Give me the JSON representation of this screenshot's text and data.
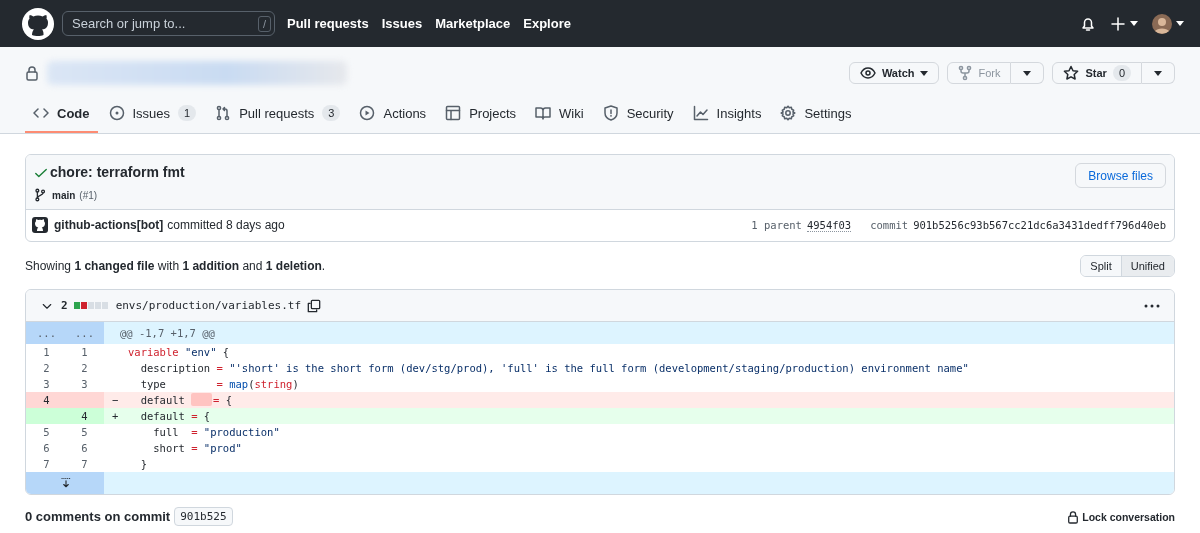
{
  "header": {
    "search": {
      "placeholder": "Search or jump to...",
      "shortcut": "/"
    },
    "nav": [
      "Pull requests",
      "Issues",
      "Marketplace",
      "Explore"
    ]
  },
  "repo": {
    "watch": {
      "label": "Watch"
    },
    "fork": {
      "label": "Fork",
      "disabled": true
    },
    "star": {
      "label": "Star",
      "count": "0"
    }
  },
  "tabs": [
    {
      "label": "Code",
      "kind": "code",
      "selected": true
    },
    {
      "label": "Issues",
      "kind": "issues",
      "count": "1",
      "selected": false
    },
    {
      "label": "Pull requests",
      "kind": "pulls",
      "count": "3",
      "selected": false
    },
    {
      "label": "Actions",
      "kind": "actions",
      "selected": false
    },
    {
      "label": "Projects",
      "kind": "projects",
      "selected": false
    },
    {
      "label": "Wiki",
      "kind": "wiki",
      "selected": false
    },
    {
      "label": "Security",
      "kind": "security",
      "selected": false
    },
    {
      "label": "Insights",
      "kind": "insights",
      "selected": false
    },
    {
      "label": "Settings",
      "kind": "settings",
      "selected": false
    }
  ],
  "commit": {
    "title": "chore: terraform fmt",
    "checks_passed": true,
    "branch": "main",
    "pr": "(#1)",
    "author": "github-actions[bot]",
    "committed": "committed 8 days ago",
    "parent_label": "1 parent",
    "parent": "4954f03",
    "commit_label": "commit",
    "sha": "901b5256c93b567cc21dc6a3431dedff796d40eb",
    "browse": "Browse files"
  },
  "summary": "Showing **1 changed file** with **1 addition** and **1 deletion**.",
  "view_modes": [
    {
      "label": "Split",
      "selected": false
    },
    {
      "label": "Unified",
      "selected": true
    }
  ],
  "file": {
    "expanded": true,
    "changes": "2",
    "diffstat": [
      {
        "kind": "added"
      },
      {
        "kind": "deleted"
      },
      {
        "kind": "neutral"
      },
      {
        "kind": "neutral"
      },
      {
        "kind": "neutral"
      }
    ],
    "path": "envs/production/variables.tf",
    "rows": [
      {
        "kind": "hunk",
        "old": "...",
        "new": "...",
        "code": [
          {
            "t": "@@ -1,7 +1,7 @@",
            "kind": "meta"
          }
        ]
      },
      {
        "kind": "context",
        "old": "1",
        "new": "1",
        "code": [
          {
            "t": "variable",
            "kind": "keyword"
          },
          {
            "t": " \"env\"",
            "kind": "string"
          },
          {
            "t": " {"
          }
        ]
      },
      {
        "kind": "context",
        "old": "2",
        "new": "2",
        "code": [
          {
            "t": "  description "
          },
          {
            "t": "=",
            "kind": "keyword"
          },
          {
            "t": " \"'short' is the short form (dev/stg/prod), 'full' is the full form (development/staging/production) environment name\"",
            "kind": "string"
          }
        ]
      },
      {
        "kind": "context",
        "old": "3",
        "new": "3",
        "code": [
          {
            "t": "  type        "
          },
          {
            "t": "=",
            "kind": "keyword"
          },
          {
            "t": " map",
            "kind": "func"
          },
          {
            "t": "("
          },
          {
            "t": "string",
            "kind": "keyword"
          },
          {
            "t": ")"
          }
        ]
      },
      {
        "kind": "del",
        "old": "4",
        "sign": "−",
        "code": [
          {
            "t": "  default "
          },
          {
            "kind": "removed"
          },
          {
            "t": "=",
            "kind": "keyword"
          },
          {
            "t": " {"
          }
        ]
      },
      {
        "kind": "add",
        "new": "4",
        "sign": "+",
        "code": [
          {
            "t": "  default "
          },
          {
            "t": "=",
            "kind": "keyword"
          },
          {
            "t": " {"
          }
        ]
      },
      {
        "kind": "context",
        "old": "5",
        "new": "5",
        "code": [
          {
            "t": "    full  "
          },
          {
            "t": "=",
            "kind": "keyword"
          },
          {
            "t": " \"production\"",
            "kind": "string"
          }
        ]
      },
      {
        "kind": "context",
        "old": "6",
        "new": "6",
        "code": [
          {
            "t": "    short "
          },
          {
            "t": "=",
            "kind": "keyword"
          },
          {
            "t": " \"prod\"",
            "kind": "string"
          }
        ]
      },
      {
        "kind": "context",
        "old": "7",
        "new": "7",
        "code": [
          {
            "t": "  }"
          }
        ]
      },
      {
        "kind": "expand"
      }
    ]
  },
  "comments": {
    "title": "0 comments on commit",
    "sha": "901b525",
    "lock": "Lock conversation"
  }
}
